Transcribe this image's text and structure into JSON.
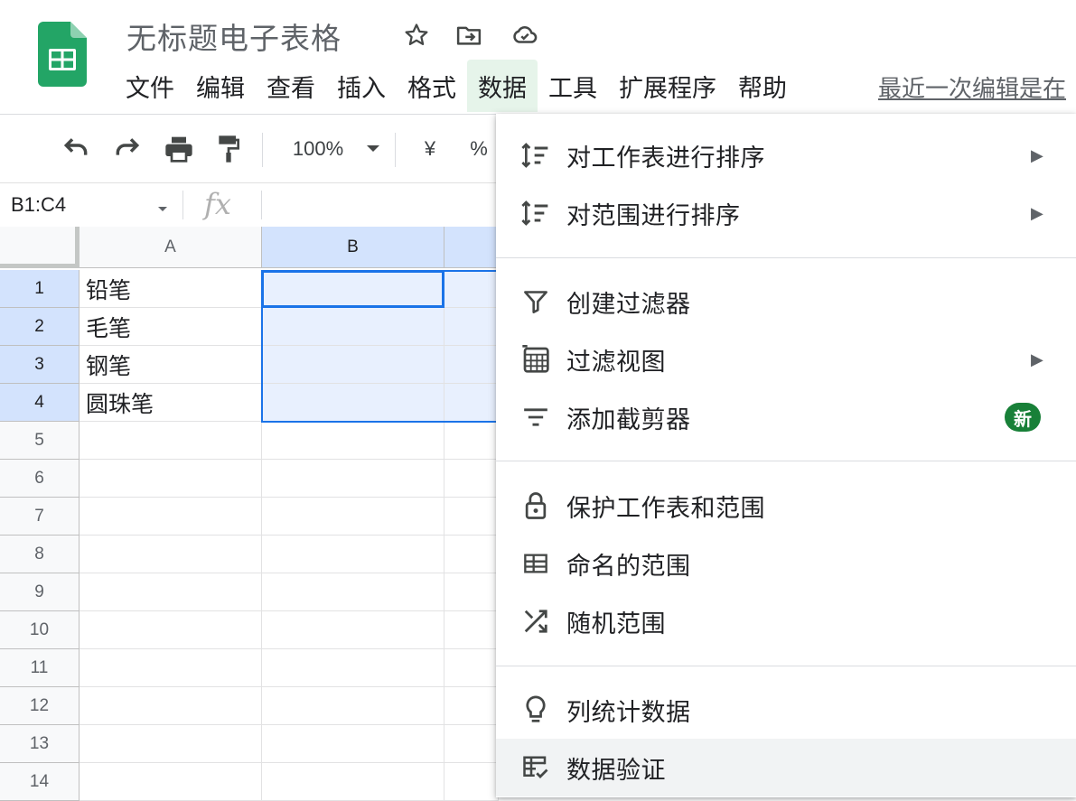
{
  "app": {
    "doc_title": "无标题电子表格",
    "last_edit": "最近一次编辑是在",
    "menubar": [
      "文件",
      "编辑",
      "查看",
      "插入",
      "格式",
      "数据",
      "工具",
      "扩展程序",
      "帮助"
    ],
    "active_menu": "数据"
  },
  "toolbar": {
    "zoom": "100%",
    "currency": "¥",
    "percent": "%"
  },
  "formula_bar": {
    "name_box": "B1:C4",
    "fx": "fx",
    "formula": ""
  },
  "sheet": {
    "columns": [
      "A",
      "B"
    ],
    "rows": [
      "1",
      "2",
      "3",
      "4",
      "5",
      "6",
      "7",
      "8",
      "9",
      "10",
      "11",
      "12",
      "13",
      "14"
    ],
    "col_a_values": [
      "铅笔",
      "毛笔",
      "钢笔",
      "圆珠笔",
      "",
      "",
      "",
      "",
      "",
      "",
      "",
      "",
      "",
      ""
    ],
    "selected_range": "B1:C4",
    "active_cell": "B1"
  },
  "data_menu": {
    "groups": [
      [
        {
          "label": "对工作表进行排序",
          "icon": "sort-icon",
          "submenu": true
        },
        {
          "label": "对范围进行排序",
          "icon": "sort-icon",
          "submenu": true
        }
      ],
      [
        {
          "label": "创建过滤器",
          "icon": "filter-icon",
          "submenu": false
        },
        {
          "label": "过滤视图",
          "icon": "filter-view-icon",
          "submenu": true
        },
        {
          "label": "添加截剪器",
          "icon": "slicer-icon",
          "submenu": false,
          "badge": "新"
        }
      ],
      [
        {
          "label": "保护工作表和范围",
          "icon": "lock-icon",
          "submenu": false
        },
        {
          "label": "命名的范围",
          "icon": "named-range-icon",
          "submenu": false
        },
        {
          "label": "随机范围",
          "icon": "shuffle-icon",
          "submenu": false
        }
      ],
      [
        {
          "label": "列统计数据",
          "icon": "lightbulb-icon",
          "submenu": false
        },
        {
          "label": "数据验证",
          "icon": "data-validation-icon",
          "submenu": false,
          "hovered": true
        }
      ]
    ]
  },
  "colors": {
    "accent": "#1a73e8",
    "sheets_green": "#23a566",
    "badge_green": "#188038",
    "selection_fill": "#e8f0fe"
  }
}
